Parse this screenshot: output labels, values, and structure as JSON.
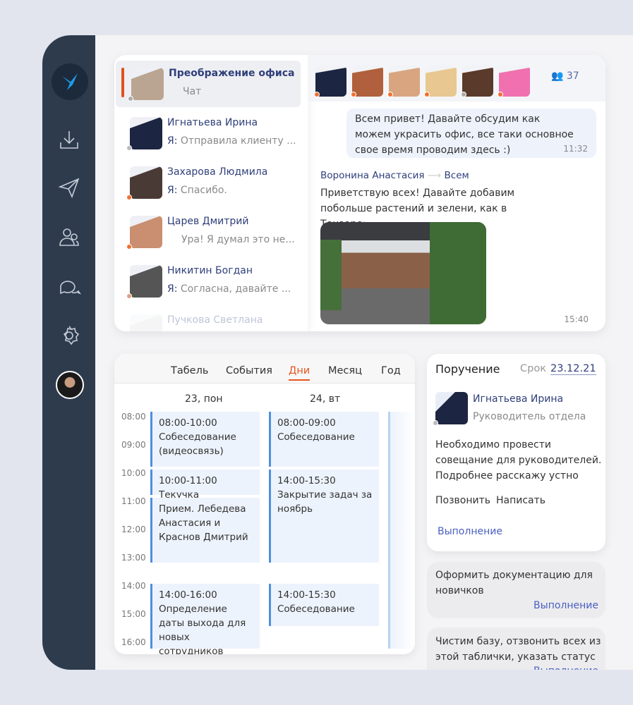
{
  "sidebar": {
    "icons": [
      "logo-icon",
      "download-icon",
      "send-icon",
      "contacts-icon",
      "chat-icon",
      "gear-icon",
      "avatar"
    ]
  },
  "chats": [
    {
      "name": "Преображение офиса",
      "sub": "Чат",
      "active": true,
      "status": "#aaaaaa",
      "color": "#b9a591"
    },
    {
      "name": "Игнатьева Ирина",
      "prefix": "Я:",
      "sub": "Отправила клиенту ...",
      "status": "#bbbbbb",
      "color": "#1c2541"
    },
    {
      "name": "Захарова Людмила",
      "prefix": "Я:",
      "sub": "Спасибо.",
      "status": "#f07030",
      "color": "#4a3a35"
    },
    {
      "name": "Царев Дмитрий",
      "sub": "Ура! Я думал это не...",
      "status": "#f07030",
      "color": "#c98f70"
    },
    {
      "name": "Никитин Богдан",
      "prefix": "Я:",
      "sub": "Согласна, давайте ...",
      "status": "#e0a080",
      "color": "#555555"
    },
    {
      "name": "Пучкова Светлана",
      "sub": "",
      "status": "#cccccc",
      "color": "#dddddd"
    }
  ],
  "conversation": {
    "members_count": "37",
    "members": [
      "#1c2541",
      "#b0603c",
      "#d8a580",
      "#e8c890",
      "#5a3a2a",
      "#f070b0"
    ],
    "my_message": {
      "text": "Всем привет! Давайте обсудим как можем украсить офис, все таки основное свое время проводим здесь :)",
      "time": "11:32"
    },
    "incoming": {
      "author": "Воронина Анастасия",
      "recipient": "Всем",
      "text": "Приветствую всех! Давайте добавим побольше растений и зелени, как в Тензоре:",
      "time": "15:40"
    }
  },
  "calendar": {
    "tabs": [
      "Табель",
      "События",
      "Дни",
      "Месяц",
      "Год"
    ],
    "active_tab": "Дни",
    "accent": "#e8541e",
    "days": [
      "23, пон",
      "24, вт"
    ],
    "hours": [
      "08:00",
      "09:00",
      "10:00",
      "11:00",
      "12:00",
      "13:00",
      "14:00",
      "15:00",
      "16:00"
    ],
    "events": [
      {
        "day": 0,
        "text1": "08:00-10:00",
        "text2": "Собеседование (видеосвязь)"
      },
      {
        "day": 0,
        "text1": "10:00-11:00 Текучка",
        "text2": ""
      },
      {
        "day": 0,
        "text1": "Прием. Лебедева Анастасия и Краснов Дмитрий",
        "text2": ""
      },
      {
        "day": 0,
        "text1": "14:00-16:00",
        "text2": "Определение даты выхода для новых сотрудников"
      },
      {
        "day": 1,
        "text1": "08:00-09:00",
        "text2": "Собеседование"
      },
      {
        "day": 1,
        "text1": "14:00-15:30",
        "text2": "Закрытие задач за ноябрь"
      },
      {
        "day": 1,
        "text1": "14:00-15:30",
        "text2": "Собеседование"
      }
    ]
  },
  "task": {
    "title": "Поручение",
    "deadline_label": "Срок",
    "deadline": "23.12.21",
    "person": "Игнатьева Ирина",
    "role": "Руководитель отдела",
    "text": "Необходимо провести совещание для руководителей. Подробнее расскажу устно",
    "call": "Позвонить",
    "write": "Написать",
    "status": "Выполнение"
  },
  "tasks": [
    {
      "text": "Оформить документацию для новичков",
      "status": "Выполнение"
    },
    {
      "text": "Чистим базу, отзвонить всех из этой таблички, указать статус",
      "status": "Выполнение"
    }
  ]
}
